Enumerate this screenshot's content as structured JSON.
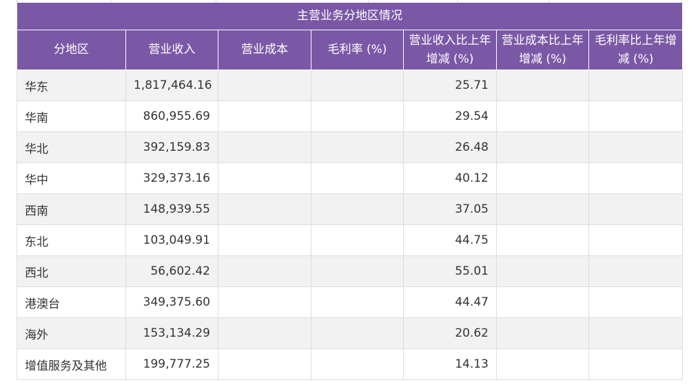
{
  "table": {
    "title": "主营业务分地区情况",
    "headers": [
      "分地区",
      "营业收入",
      "营业成本",
      "毛利率 (%)",
      "营业收入比上年增减 (%)",
      "营业成本比上年增减 (%)",
      "毛利率比上年增减 (%)"
    ],
    "rows": [
      [
        "华东",
        "1,817,464.16",
        "",
        "",
        "25.71",
        "",
        ""
      ],
      [
        "华南",
        "860,955.69",
        "",
        "",
        "29.54",
        "",
        ""
      ],
      [
        "华北",
        "392,159.83",
        "",
        "",
        "26.48",
        "",
        ""
      ],
      [
        "华中",
        "329,373.16",
        "",
        "",
        "40.12",
        "",
        ""
      ],
      [
        "西南",
        "148,939.55",
        "",
        "",
        "37.05",
        "",
        ""
      ],
      [
        "东北",
        "103,049.91",
        "",
        "",
        "44.75",
        "",
        ""
      ],
      [
        "西北",
        "56,602.42",
        "",
        "",
        "55.01",
        "",
        ""
      ],
      [
        "港澳台",
        "349,375.60",
        "",
        "",
        "44.47",
        "",
        ""
      ],
      [
        "海外",
        "153,134.29",
        "",
        "",
        "20.62",
        "",
        ""
      ],
      [
        "增值服务及其他",
        "199,777.25",
        "",
        "",
        "14.13",
        "",
        ""
      ]
    ]
  }
}
